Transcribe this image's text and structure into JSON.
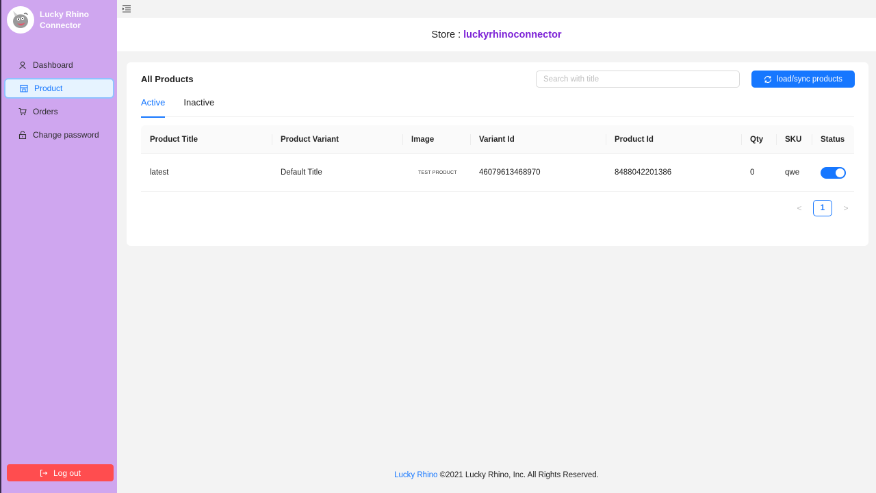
{
  "app": {
    "brand_name": "Lucky Rhino Connector"
  },
  "sidebar": {
    "items": [
      {
        "label": "Dashboard",
        "icon": "user-icon",
        "active": false
      },
      {
        "label": "Product",
        "icon": "shop-icon",
        "active": true
      },
      {
        "label": "Orders",
        "icon": "cart-icon",
        "active": false
      },
      {
        "label": "Change password",
        "icon": "lock-icon",
        "active": false
      }
    ],
    "logout_label": "Log out"
  },
  "header": {
    "store_label": "Store :",
    "store_name": "luckyrhinoconnector"
  },
  "products": {
    "title": "All Products",
    "search_placeholder": "Search with title",
    "search_value": "",
    "sync_label": "load/sync products",
    "tabs": [
      {
        "label": "Active",
        "active": true
      },
      {
        "label": "Inactive",
        "active": false
      }
    ],
    "columns": [
      "Product Title",
      "Product Variant",
      "Image",
      "Variant Id",
      "Product Id",
      "Qty",
      "SKU",
      "Status"
    ],
    "rows": [
      {
        "title": "latest",
        "variant": "Default Title",
        "image_text": "TEST PRODUCT",
        "variant_id": "46079613468970",
        "product_id": "8488042201386",
        "qty": "0",
        "sku": "qwe",
        "status_on": true
      }
    ],
    "pagination": {
      "current_page": "1"
    }
  },
  "footer": {
    "link_text": "Lucky Rhino",
    "text": "©2021 Lucky Rhino, Inc. All Rights Reserved."
  },
  "colors": {
    "sidebar_bg": "#cfa6ef",
    "primary": "#1677ff",
    "store_name": "#7b1fd6",
    "logout": "#ff4d4f"
  }
}
